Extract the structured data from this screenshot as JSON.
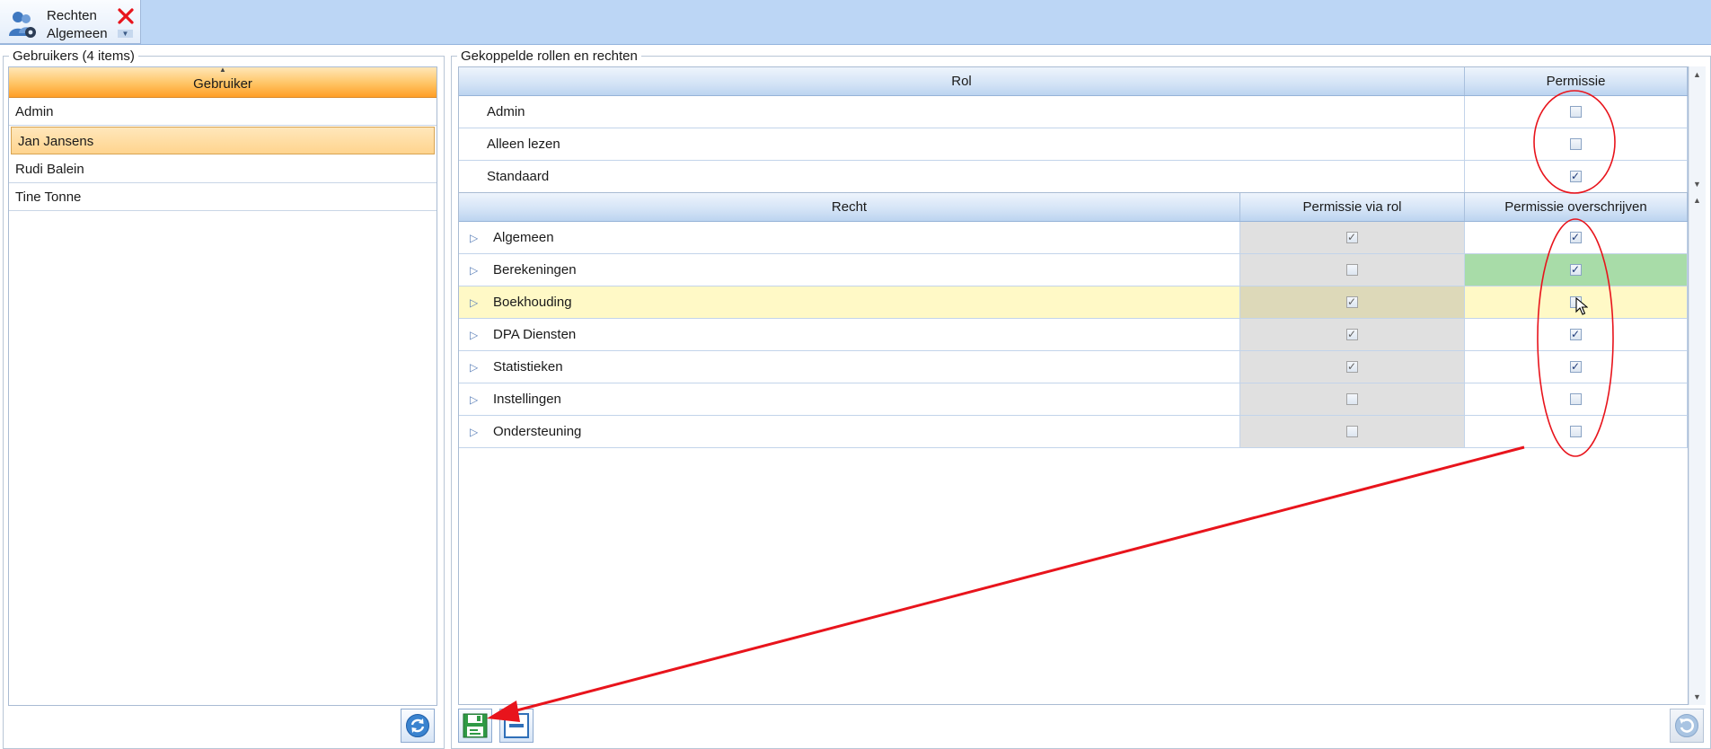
{
  "tab": {
    "title_line1": "Rechten",
    "title_line2": "Algemeen"
  },
  "users_panel": {
    "legend": "Gebruikers (4 items)",
    "column": "Gebruiker",
    "rows": [
      {
        "name": "Admin",
        "selected": false
      },
      {
        "name": "Jan Jansens",
        "selected": true
      },
      {
        "name": "Rudi Balein",
        "selected": false
      },
      {
        "name": "Tine Tonne",
        "selected": false
      }
    ]
  },
  "rights_panel": {
    "legend": "Gekoppelde rollen en rechten",
    "roles_columns": {
      "rol": "Rol",
      "permissie": "Permissie"
    },
    "roles": [
      {
        "name": "Admin",
        "checked": false
      },
      {
        "name": "Alleen lezen",
        "checked": false
      },
      {
        "name": "Standaard",
        "checked": true
      }
    ],
    "rights_columns": {
      "recht": "Recht",
      "via_rol": "Permissie via rol",
      "overschrijven": "Permissie overschrijven"
    },
    "rights": [
      {
        "name": "Algemeen",
        "via_rol": true,
        "override": true,
        "state": ""
      },
      {
        "name": "Berekeningen",
        "via_rol": false,
        "override": true,
        "state": "changed"
      },
      {
        "name": "Boekhouding",
        "via_rol": true,
        "override": false,
        "state": "hover"
      },
      {
        "name": "DPA Diensten",
        "via_rol": true,
        "override": true,
        "state": ""
      },
      {
        "name": "Statistieken",
        "via_rol": true,
        "override": true,
        "state": ""
      },
      {
        "name": "Instellingen",
        "via_rol": false,
        "override": false,
        "state": ""
      },
      {
        "name": "Ondersteuning",
        "via_rol": false,
        "override": false,
        "state": ""
      }
    ]
  },
  "icons": {
    "tab": "users-settings-icon",
    "close": "close-icon",
    "refresh": "refresh-icon",
    "save": "save-icon",
    "collapse": "collapse-icon",
    "undo": "undo-icon"
  },
  "colors": {
    "header_orange": "#ffb347",
    "header_blue": "#cfe0f5",
    "changed_green": "#a8dca8",
    "hover_yellow": "#fff9c6",
    "annotation_red": "#e8141c"
  }
}
